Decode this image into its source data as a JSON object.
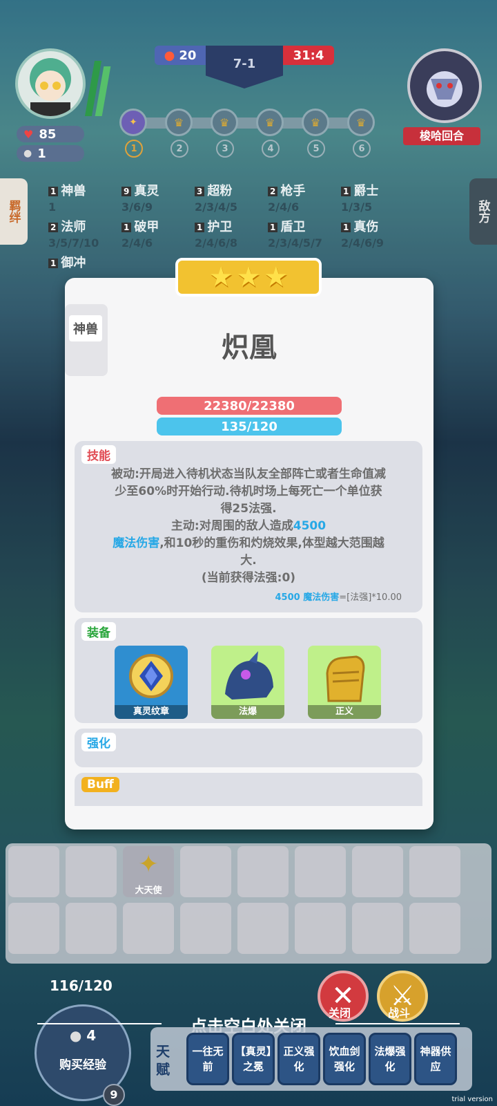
{
  "hud": {
    "player_hp": "85",
    "player_coins": "1",
    "left_score": "20",
    "stage": "7-1",
    "timer": "31:4",
    "opponent_label": "梭哈回合",
    "rounds": [
      "1",
      "2",
      "3",
      "4",
      "5",
      "6"
    ]
  },
  "synergies": [
    {
      "count": "1",
      "name": "神兽",
      "levels": "1"
    },
    {
      "count": "9",
      "name": "真灵",
      "levels": "3/6/9"
    },
    {
      "count": "3",
      "name": "超粉",
      "levels": "2/3/4/5"
    },
    {
      "count": "2",
      "name": "枪手",
      "levels": "2/4/6"
    },
    {
      "count": "1",
      "name": "爵士",
      "levels": "1/3/5"
    },
    {
      "count": "2",
      "name": "法师",
      "levels": "3/5/7/10"
    },
    {
      "count": "1",
      "name": "破甲",
      "levels": "2/4/6"
    },
    {
      "count": "1",
      "name": "护卫",
      "levels": "2/4/6/8"
    },
    {
      "count": "1",
      "name": "盾卫",
      "levels": "2/3/4/5/7"
    },
    {
      "count": "1",
      "name": "真伤",
      "levels": "2/4/6/9"
    },
    {
      "count": "1",
      "name": "御冲",
      "levels": ""
    }
  ],
  "side_tabs": {
    "left": "羁绊",
    "right": "敌方"
  },
  "unit": {
    "race": "神兽",
    "name": "炽凰",
    "hp": "22380/22380",
    "mana": "135/120",
    "hp_fraction": 1.0,
    "mana_fraction": 1.0
  },
  "skill": {
    "label": "技能",
    "line1": "被动:开局进入待机状态当队友全部阵亡或者生命值减",
    "line2": "少至60%时开始行动.待机时场上每死亡一个单位获",
    "line3": "得25法强.",
    "line4_pre": "主动:对周围的敌人造成",
    "line4_hl": "4500",
    "line5_hl": "魔法伤害",
    "line5_post": ",和10秒的重伤和灼烧效果,体型越大范围越",
    "line6": "大.",
    "line7": "(当前获得法强:0)",
    "formula_hl": "4500 魔法伤害",
    "formula_post": "=[法强]*10.00"
  },
  "equipment": {
    "label": "装备",
    "items": [
      {
        "name": "真灵纹章",
        "icon": "emblem-icon"
      },
      {
        "name": "法爆",
        "icon": "dragon-helm-icon"
      },
      {
        "name": "正义",
        "icon": "golden-gauntlet-icon"
      }
    ]
  },
  "enhance": {
    "label": "强化"
  },
  "buff": {
    "label": "Buff"
  },
  "bench": {
    "item_label": "大天使"
  },
  "bottom": {
    "xp": "116/120",
    "buy_cost": "4",
    "buy_label": "购买经验",
    "level": "9",
    "close_hint": "点击空白处关闭",
    "close_btn": "关闭",
    "fight_btn": "战斗",
    "talent_label": "天赋",
    "chips": [
      "一往无前",
      "【真灵】之冕",
      "正义强化",
      "饮血剑强化",
      "法爆强化",
      "神器供应"
    ]
  },
  "watermark": "trial version",
  "colors": {
    "hp": "#ef6f74",
    "mana": "#4cc4ec",
    "star": "#f2c230",
    "highlight": "#27a8e6"
  }
}
